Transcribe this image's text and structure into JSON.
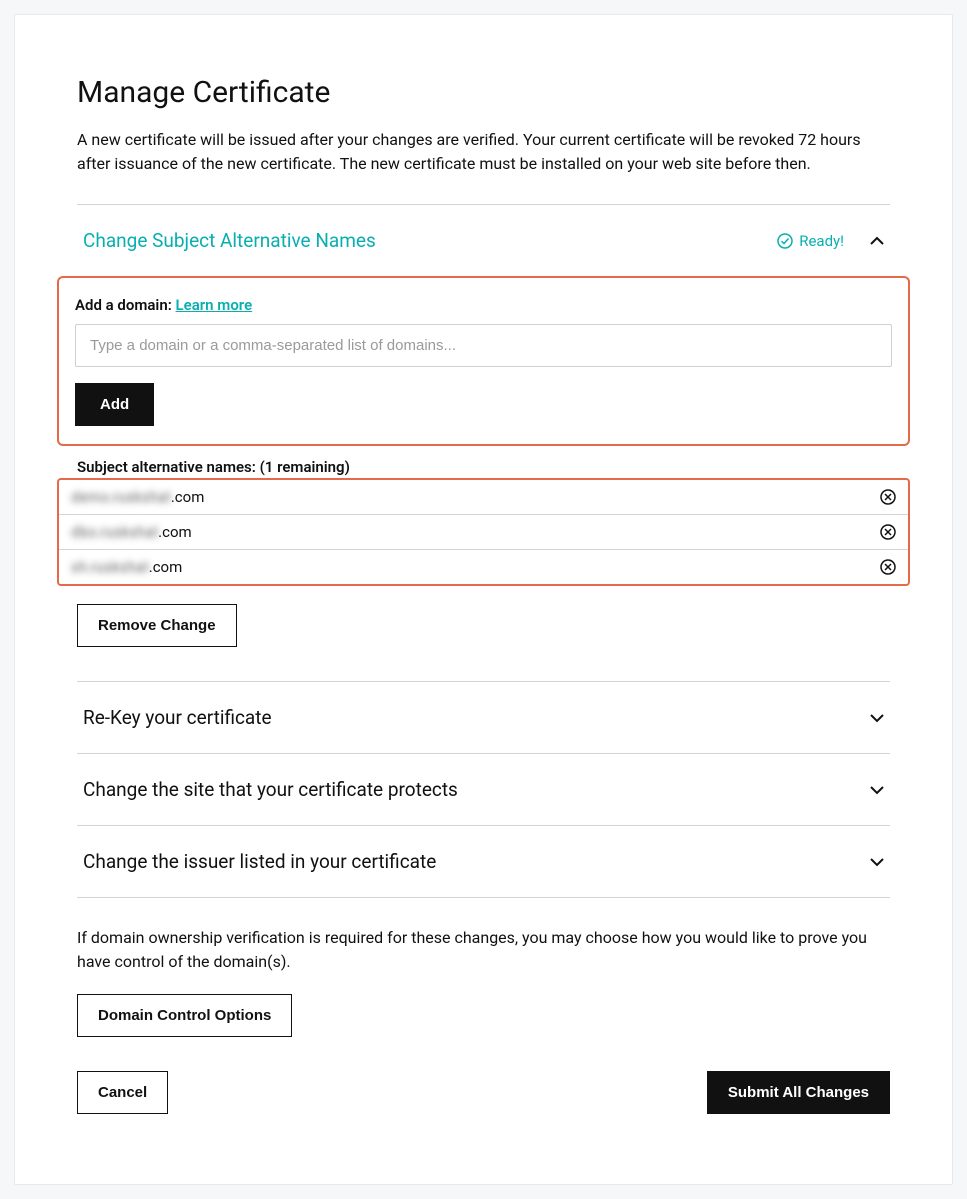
{
  "page": {
    "title": "Manage Certificate",
    "intro": "A new certificate will be issued after your changes are verified. Your current certificate will be revoked 72 hours after issuance of the new certificate. The new certificate must be installed on your web site before then."
  },
  "sections": {
    "san": {
      "title": "Change Subject Alternative Names",
      "status": "Ready!",
      "add_label": "Add a domain",
      "learn_more": "Learn more",
      "input_placeholder": "Type a domain or a comma-separated list of domains...",
      "add_button": "Add",
      "list_heading": "Subject alternative names: (1 remaining)",
      "domains": [
        {
          "obscured": "demo.ruskshat",
          "suffix": ".com"
        },
        {
          "obscured": "dbo.ruskshat",
          "suffix": ".com"
        },
        {
          "obscured": "sh.ruskshat",
          "suffix": ".com"
        }
      ],
      "remove_change": "Remove Change"
    },
    "rekey": {
      "title": "Re-Key your certificate"
    },
    "change_site": {
      "title": "Change the site that your certificate protects"
    },
    "change_issuer": {
      "title": "Change the issuer listed in your certificate"
    }
  },
  "footer": {
    "note": "If domain ownership verification is required for these changes, you may choose how you would like to prove you have control of the domain(s).",
    "domain_control": "Domain Control Options",
    "cancel": "Cancel",
    "submit": "Submit All Changes"
  }
}
